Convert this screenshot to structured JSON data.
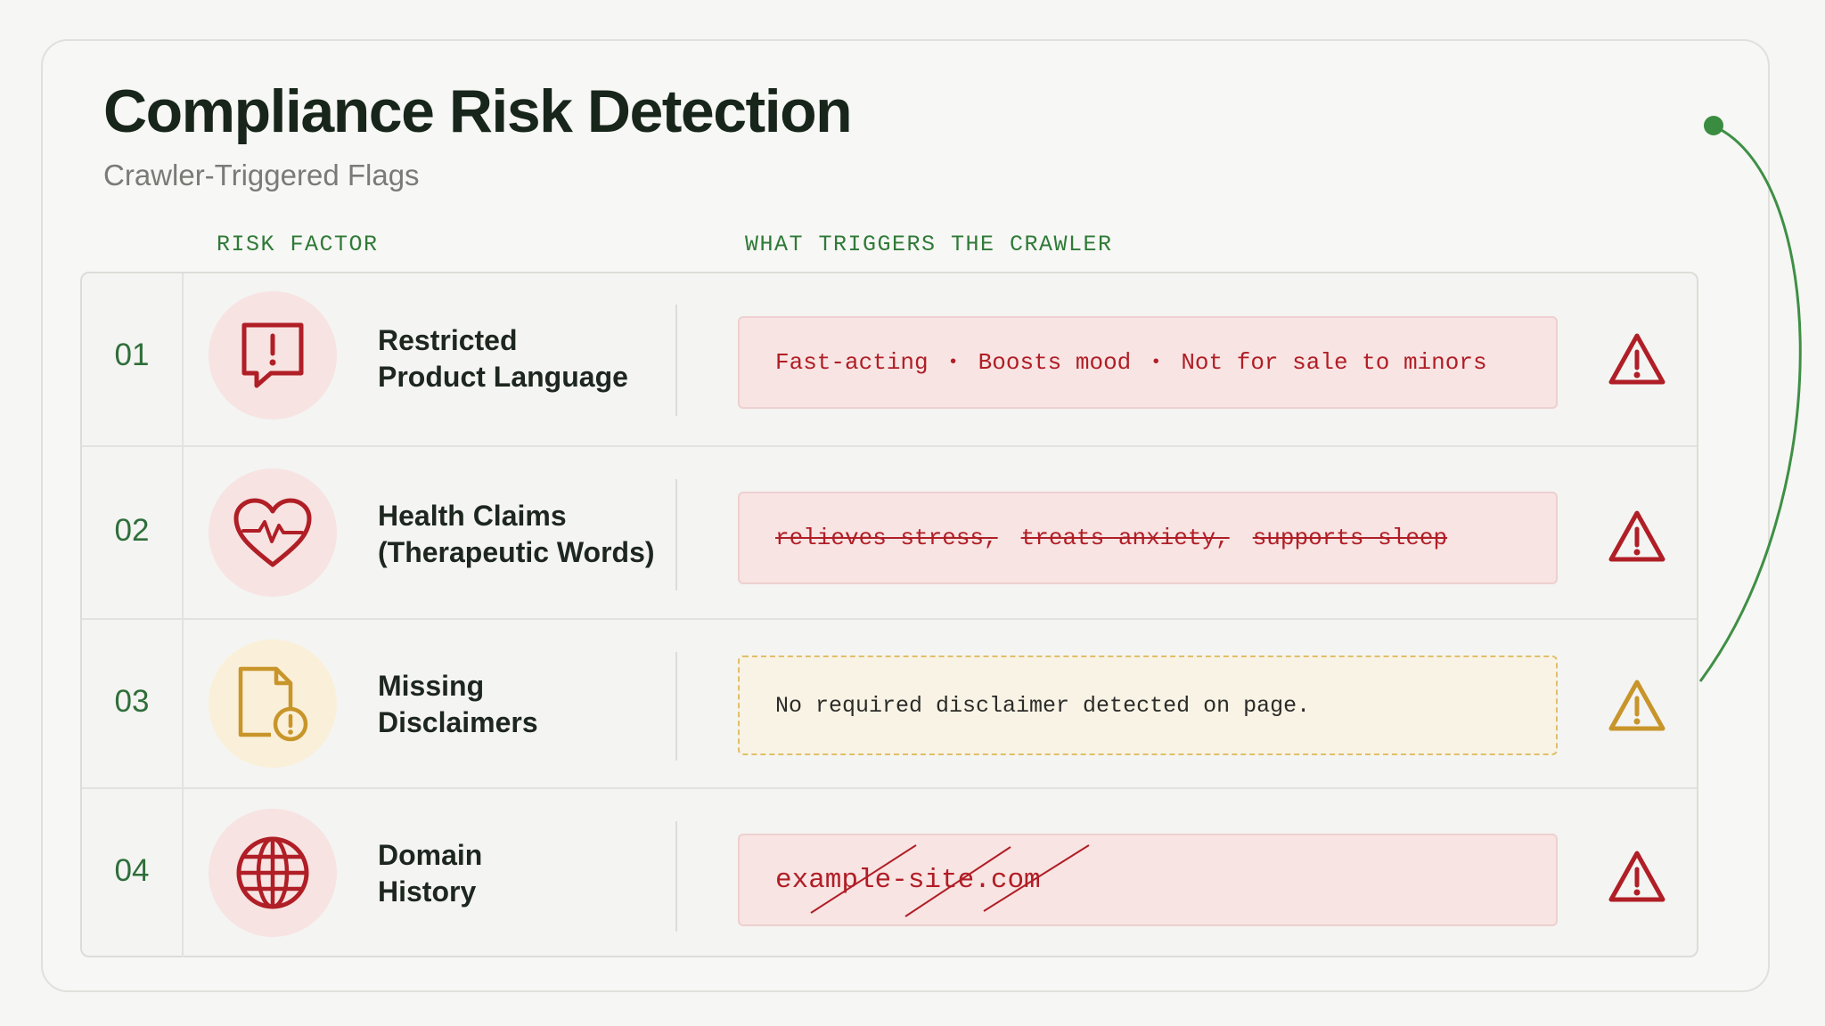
{
  "header": {
    "title": "Compliance Risk Detection",
    "subtitle": "Crawler-Triggered Flags"
  },
  "columns": {
    "risk_factor": "RISK FACTOR",
    "triggers": "WHAT TRIGGERS THE CRAWLER"
  },
  "rows": [
    {
      "number": "01",
      "icon": "speech-bubble-exclamation-icon",
      "label_line1": "Restricted",
      "label_line2": "Product Language",
      "triggers": [
        "Fast-acting",
        "Boosts mood",
        "Not for sale to minors"
      ],
      "severity": "high"
    },
    {
      "number": "02",
      "icon": "heart-pulse-icon",
      "label_line1": "Health Claims",
      "label_line2": "(Therapeutic Words)",
      "triggers": [
        "relieves stress,",
        "treats anxiety,",
        "supports sleep"
      ],
      "severity": "high"
    },
    {
      "number": "03",
      "icon": "document-warning-icon",
      "label_line1": "Missing",
      "label_line2": "Disclaimers",
      "trigger_text": "No required disclaimer detected on page.",
      "severity": "medium"
    },
    {
      "number": "04",
      "icon": "globe-icon",
      "label_line1": "Domain",
      "label_line2": "History",
      "trigger_text": "example-site.com",
      "severity": "high"
    }
  ],
  "colors": {
    "accent_green": "#2f7a37",
    "danger_red": "#b01e26",
    "warning_amber": "#c8952a"
  }
}
